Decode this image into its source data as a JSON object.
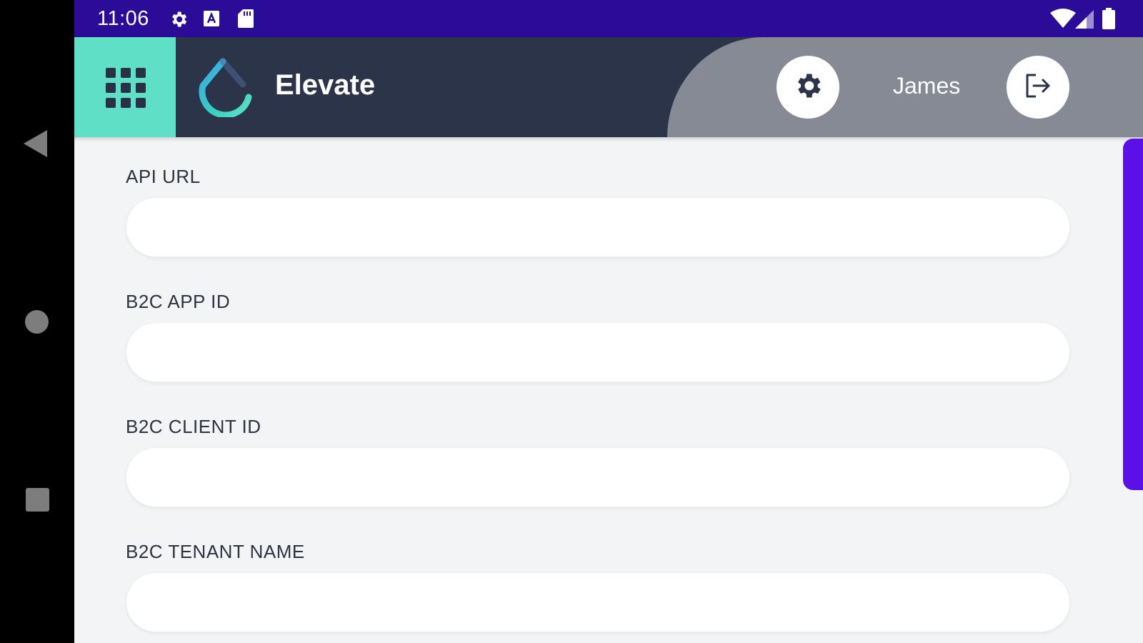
{
  "status_bar": {
    "time": "11:06",
    "icons_left": [
      "settings-icon",
      "a-badge-icon",
      "sd-card-icon"
    ],
    "icons_right": [
      "wifi-icon",
      "cell-signal-icon",
      "battery-icon"
    ],
    "color": "#2a0c98"
  },
  "header": {
    "app_title": "Elevate",
    "user_name": "James",
    "apps_button_color": "#5fe0c6",
    "background_color": "#2b3448",
    "user_area_color": "#858a95"
  },
  "form": {
    "fields": [
      {
        "label": "API URL",
        "value": "",
        "placeholder": ""
      },
      {
        "label": "B2C APP ID",
        "value": "",
        "placeholder": ""
      },
      {
        "label": "B2C CLIENT ID",
        "value": "",
        "placeholder": ""
      },
      {
        "label": "B2C TENANT NAME",
        "value": "",
        "placeholder": ""
      }
    ]
  },
  "colors": {
    "accent_teal": "#5fe0c6",
    "scrollbar": "#5a10e6",
    "content_bg": "#f3f4f6"
  }
}
